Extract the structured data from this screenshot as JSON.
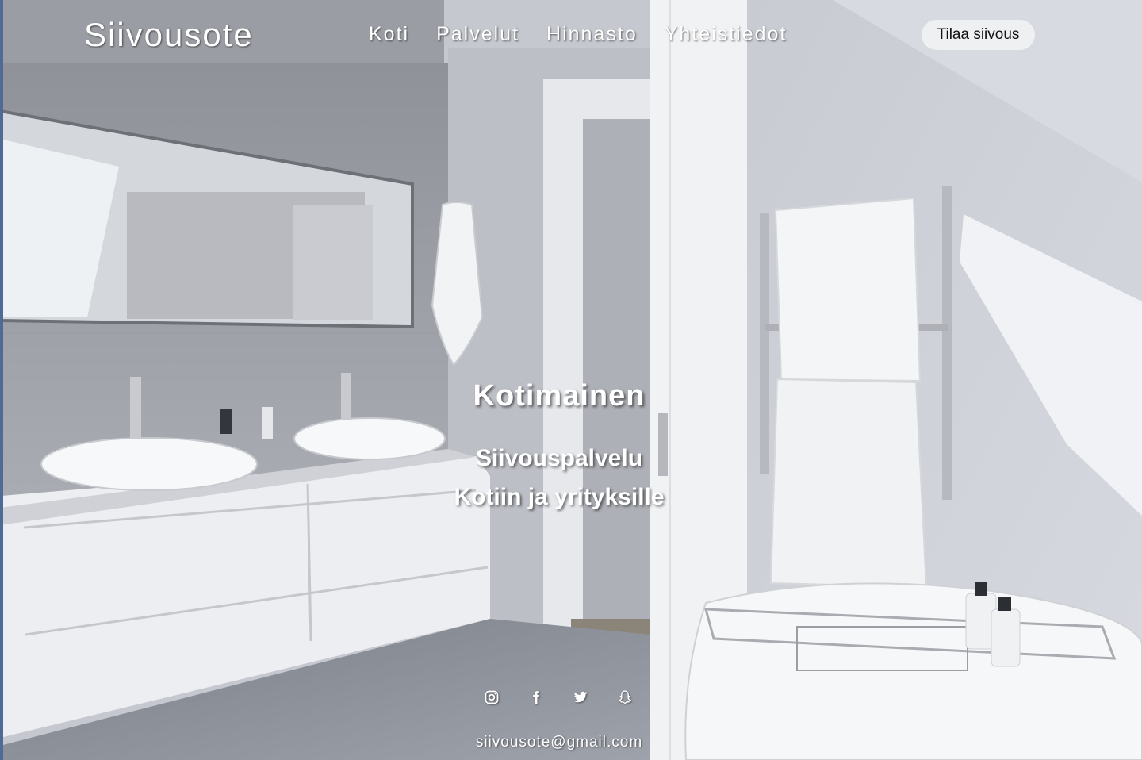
{
  "brand": {
    "name": "Siivousote"
  },
  "nav": {
    "items": [
      {
        "label": "Koti"
      },
      {
        "label": "Palvelut"
      },
      {
        "label": "Hinnasto"
      },
      {
        "label": "Yhteistiedot"
      }
    ],
    "cta_label": "Tilaa siivous"
  },
  "hero": {
    "title": "Kotimainen",
    "subtitle_lines": [
      "Siivouspalvelu",
      "Kotiin ja yrityksille"
    ]
  },
  "social": [
    {
      "icon": "instagram-icon"
    },
    {
      "icon": "facebook-icon"
    },
    {
      "icon": "twitter-icon"
    },
    {
      "icon": "snapchat-icon"
    }
  ],
  "footer": {
    "email": "siivousote@gmail.com"
  },
  "colors": {
    "text": "#ffffff",
    "cta_background": "#eef0f2",
    "cta_text": "#111111",
    "left_edge_strip": "#4f6a97"
  }
}
